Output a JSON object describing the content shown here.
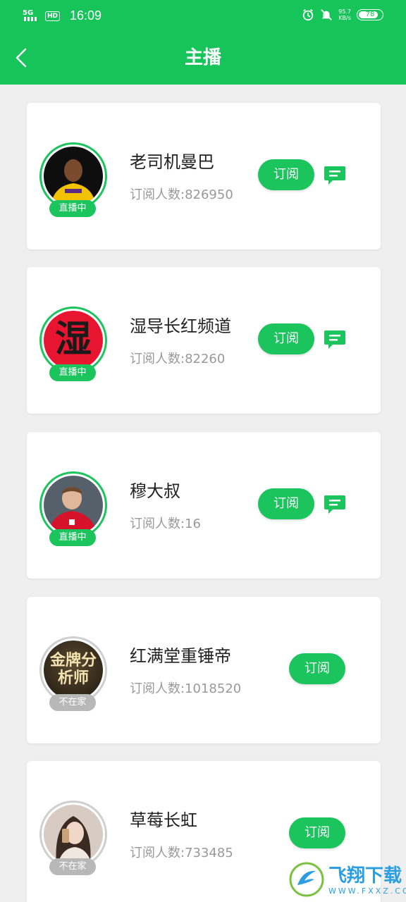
{
  "status_bar": {
    "network": "5G",
    "hd": "HD",
    "time": "16:09",
    "speed_value": "95.7",
    "speed_unit": "KB/s",
    "battery": "78"
  },
  "header": {
    "title": "主播"
  },
  "anchors": [
    {
      "name": "老司机曼巴",
      "subscribers": "订阅人数:826950",
      "status": "直播中",
      "subscribe_label": "订阅",
      "online": true
    },
    {
      "name": "湿导长红频道",
      "subscribers": "订阅人数:82260",
      "status": "直播中",
      "subscribe_label": "订阅",
      "online": true,
      "avatar_text": "湿"
    },
    {
      "name": "穆大叔",
      "subscribers": "订阅人数:16",
      "status": "直播中",
      "subscribe_label": "订阅",
      "online": true
    },
    {
      "name": "红满堂重锤帝",
      "subscribers": "订阅人数:1018520",
      "status": "不在家",
      "subscribe_label": "订阅",
      "online": false,
      "avatar_text": "金牌分析师"
    },
    {
      "name": "草莓长虹",
      "subscribers": "订阅人数:733485",
      "status": "不在家",
      "subscribe_label": "订阅",
      "online": false
    }
  ],
  "watermark": {
    "text": "飞翔下载",
    "url": "WWW.FXXZ.COM"
  },
  "colors": {
    "brand": "#16c45a",
    "button": "#1bc45c",
    "offline": "#b8b8b8"
  }
}
